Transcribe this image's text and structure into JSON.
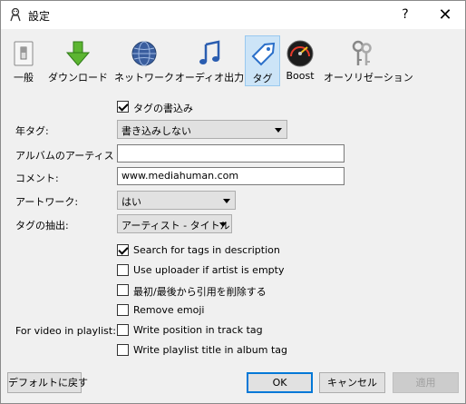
{
  "window": {
    "title": "設定",
    "help_label": "?",
    "close_label": "✕"
  },
  "toolbar": {
    "items": [
      {
        "label": "一般",
        "icon": "switch-icon"
      },
      {
        "label": "ダウンロード",
        "icon": "download-arrow-icon"
      },
      {
        "label": "ネットワーク",
        "icon": "globe-icon"
      },
      {
        "label": "オーディオ出力",
        "icon": "music-note-icon"
      },
      {
        "label": "タグ",
        "icon": "tag-icon",
        "active": true
      },
      {
        "label": "Boost",
        "icon": "speedometer-icon"
      },
      {
        "label": "オーソリゼーション",
        "icon": "keys-icon"
      }
    ]
  },
  "form": {
    "write_tags": {
      "label": "タグの書込み",
      "checked": true
    },
    "year_tag": {
      "label": "年タグ:",
      "value": "書き込みしない"
    },
    "album_artist": {
      "label": "アルバムのアーティスト:",
      "value": ""
    },
    "comment": {
      "label": "コメント:",
      "value": "www.mediahuman.com"
    },
    "artwork": {
      "label": "アートワーク:",
      "value": "はい"
    },
    "tag_extract": {
      "label": "タグの抽出:",
      "value": "アーティスト - タイトル"
    },
    "search_desc": {
      "label": "Search for tags in description",
      "checked": true
    },
    "use_uploader": {
      "label": "Use uploader if artist is empty",
      "checked": false
    },
    "remove_quotes": {
      "label": "最初/最後から引用を削除する",
      "checked": false
    },
    "remove_emoji": {
      "label": "Remove emoji",
      "checked": false
    },
    "playlist_label": "For video in playlist:",
    "write_position": {
      "label": "Write position in track tag",
      "checked": false
    },
    "write_playlist_title": {
      "label": "Write playlist title in album tag",
      "checked": false
    }
  },
  "buttons": {
    "defaults": "デフォルトに戻す",
    "ok": "OK",
    "cancel": "キャンセル",
    "apply": "適用"
  },
  "colors": {
    "active_tab": "#cce4f7",
    "accent": "#0078d7"
  }
}
